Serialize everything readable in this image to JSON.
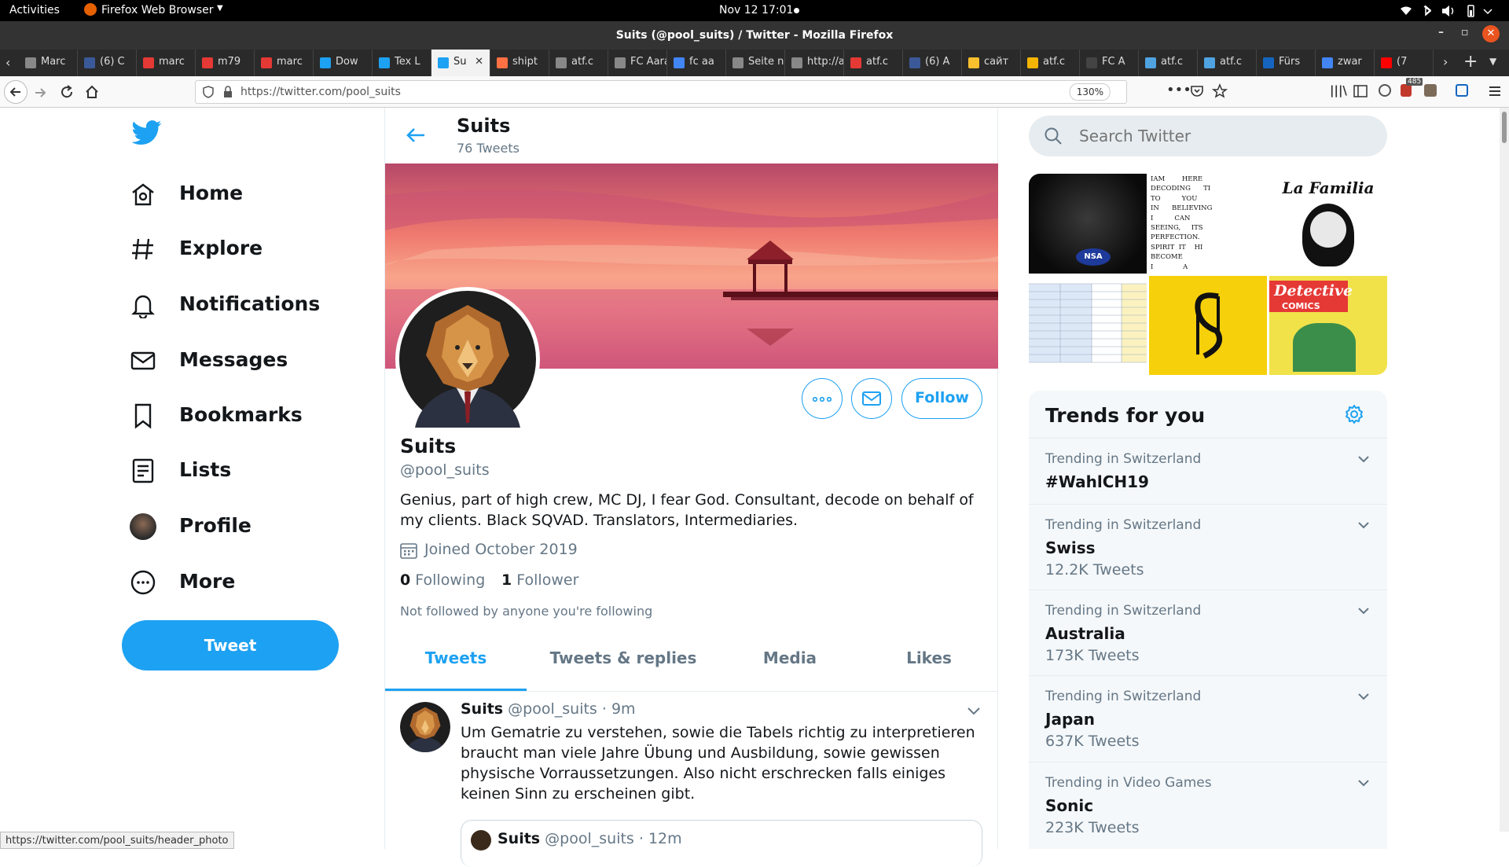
{
  "system_bar": {
    "activities": "Activities",
    "app_name": "Firefox Web Browser",
    "clock": "Nov 12  17:01"
  },
  "window": {
    "title": "Suits (@pool_suits) / Twitter - Mozilla Firefox"
  },
  "tabs": [
    {
      "label": "Marc",
      "color": "#888"
    },
    {
      "label": "(6) C",
      "color": "#3b5998"
    },
    {
      "label": "marc",
      "color": "#e53935"
    },
    {
      "label": "m79",
      "color": "#e53935"
    },
    {
      "label": "marc",
      "color": "#e53935"
    },
    {
      "label": "Dow",
      "color": "#1da1f2"
    },
    {
      "label": "Tex L",
      "color": "#1da1f2"
    },
    {
      "label": "Su",
      "color": "#1da1f2"
    },
    {
      "label": "shipt",
      "color": "#ff7043"
    },
    {
      "label": "atf.c",
      "color": "#888"
    },
    {
      "label": "FC Aara",
      "color": "#888"
    },
    {
      "label": "fc aa",
      "color": "#4285f4"
    },
    {
      "label": "Seite nic",
      "color": "#888"
    },
    {
      "label": "http://a",
      "color": "#888"
    },
    {
      "label": "atf.c",
      "color": "#e53935"
    },
    {
      "label": "(6) A",
      "color": "#3b5998"
    },
    {
      "label": "сайт",
      "color": "#fbc02d"
    },
    {
      "label": "atf.c",
      "color": "#f4b400"
    },
    {
      "label": "FC A",
      "color": "#444"
    },
    {
      "label": "atf.c",
      "color": "#4fa3e0"
    },
    {
      "label": "atf.c",
      "color": "#4fa3e0"
    },
    {
      "label": "Fürs",
      "color": "#1565c0"
    },
    {
      "label": "zwar",
      "color": "#4285f4"
    },
    {
      "label": "(7",
      "color": "#ff0000"
    }
  ],
  "urlbar": {
    "url": "https://twitter.com/pool_suits",
    "zoom": "130%",
    "extension_badge": "485"
  },
  "status_url": "https://twitter.com/pool_suits/header_photo",
  "leftnav": {
    "items": [
      {
        "label": "Home",
        "icon": "home-icon"
      },
      {
        "label": "Explore",
        "icon": "hashtag-icon"
      },
      {
        "label": "Notifications",
        "icon": "bell-icon"
      },
      {
        "label": "Messages",
        "icon": "envelope-icon"
      },
      {
        "label": "Bookmarks",
        "icon": "bookmark-icon"
      },
      {
        "label": "Lists",
        "icon": "list-icon"
      },
      {
        "label": "Profile",
        "icon": "avatar"
      },
      {
        "label": "More",
        "icon": "more-icon"
      }
    ],
    "tweet_button": "Tweet"
  },
  "header": {
    "name": "Suits",
    "tweet_count": "76 Tweets"
  },
  "profile": {
    "name": "Suits",
    "handle": "@pool_suits",
    "bio": "Genius, part of high crew, MC DJ, I fear God. Consultant, decode on behalf of my clients. Black SQVAD. Translators, Intermediaries.",
    "joined": "Joined October 2019",
    "following_count": "0",
    "following_label": "Following",
    "followers_count": "1",
    "followers_label": "Follower",
    "followed_by": "Not followed by anyone you're following",
    "follow_button": "Follow"
  },
  "profile_tabs": [
    "Tweets",
    "Tweets & replies",
    "Media",
    "Likes"
  ],
  "tweet": {
    "name": "Suits",
    "handle": "@pool_suits",
    "time": "· 9m",
    "text": "Um Gematrie zu verstehen, sowie die Tabels richtig zu interpretieren braucht man viele Jahre Übung und Ausbildung, sowie gewissen physische Vorraussetzungen. Also nicht erschrecken falls einiges keinen Sinn zu erscheinen gibt.",
    "quoted": {
      "name": "Suits",
      "handle": "@pool_suits",
      "time": "· 12m"
    }
  },
  "search": {
    "placeholder": "Search Twitter"
  },
  "media_grid": {
    "text_tile_lines": [
      "IAM        HERE",
      "DECODING      TI",
      "TO          YOU",
      "IN      BELIEVING",
      "I          CAN",
      "SEEING,     ITS",
      "PERFECTION.",
      "SPIRIT  IT    HI",
      "BECOME",
      "I              A"
    ],
    "nsa_label": "NSA",
    "lafamilia_label": "La Familia",
    "detective_label": "Detective",
    "comics_label": "COMICS"
  },
  "trends": {
    "title": "Trends for you",
    "items": [
      {
        "context": "Trending in Switzerland",
        "name": "#WahlCH19",
        "count": ""
      },
      {
        "context": "Trending in Switzerland",
        "name": "Swiss",
        "count": "12.2K Tweets"
      },
      {
        "context": "Trending in Switzerland",
        "name": "Australia",
        "count": "173K Tweets"
      },
      {
        "context": "Trending in Switzerland",
        "name": "Japan",
        "count": "637K Tweets"
      },
      {
        "context": "Trending in Video Games",
        "name": "Sonic",
        "count": "223K Tweets"
      }
    ]
  },
  "colors": {
    "twitter_blue": "#1da1f2",
    "text_dark": "#14171a",
    "text_gray": "#657786"
  }
}
